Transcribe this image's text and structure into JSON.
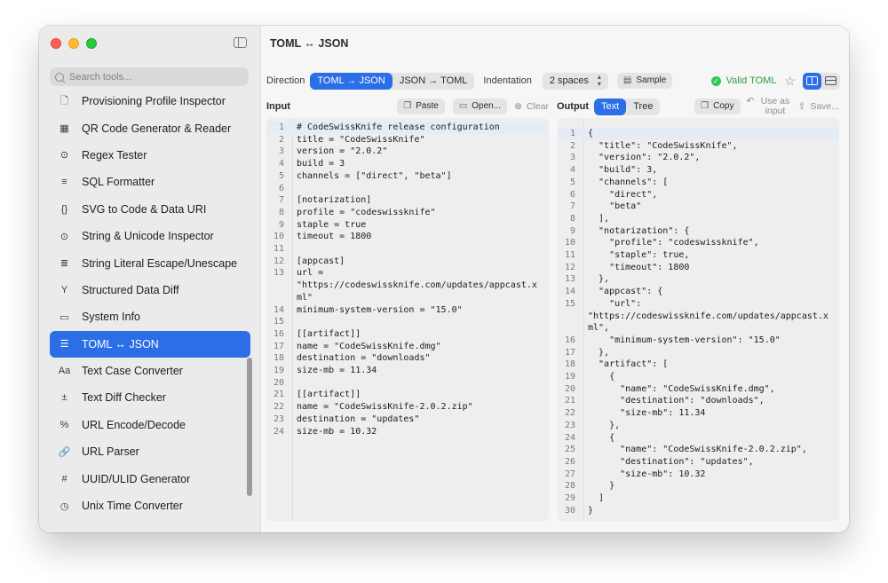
{
  "window": {
    "title": "TOML ↔ JSON"
  },
  "sidebar": {
    "search_placeholder": "Search tools...",
    "items": [
      {
        "label": "Provisioning Profile Inspector",
        "icon": "document-lock-icon",
        "glyph": "🗋",
        "active": false
      },
      {
        "label": "QR Code Generator & Reader",
        "icon": "qrcode-icon",
        "glyph": "▦",
        "active": false
      },
      {
        "label": "Regex Tester",
        "icon": "magnifier-icon",
        "glyph": "⊙",
        "active": false
      },
      {
        "label": "SQL Formatter",
        "icon": "text-align-left-icon",
        "glyph": "≡",
        "active": false
      },
      {
        "label": "SVG to Code & Data URI",
        "icon": "curly-braces-icon",
        "glyph": "{}",
        "active": false
      },
      {
        "label": "String & Unicode Inspector",
        "icon": "magnifier-text-icon",
        "glyph": "⊙",
        "active": false
      },
      {
        "label": "String Literal Escape/Unescape",
        "icon": "text-format-icon",
        "glyph": "≣",
        "active": false
      },
      {
        "label": "Structured Data Diff",
        "icon": "branch-merge-icon",
        "glyph": "Y",
        "active": false
      },
      {
        "label": "System Info",
        "icon": "display-icon",
        "glyph": "▭",
        "active": false
      },
      {
        "label": "TOML ↔ JSON",
        "icon": "sliders-icon",
        "glyph": "☰",
        "active": true
      },
      {
        "label": "Text Case Converter",
        "icon": "text-case-icon",
        "glyph": "Aa",
        "active": false
      },
      {
        "label": "Text Diff Checker",
        "icon": "plus-minus-icon",
        "glyph": "±",
        "active": false
      },
      {
        "label": "URL Encode/Decode",
        "icon": "percent-icon",
        "glyph": "%",
        "active": false
      },
      {
        "label": "URL Parser",
        "icon": "link-icon",
        "glyph": "🔗",
        "active": false
      },
      {
        "label": "UUID/ULID Generator",
        "icon": "number-square-icon",
        "glyph": "#",
        "active": false
      },
      {
        "label": "Unix Time Converter",
        "icon": "clock-icon",
        "glyph": "◷",
        "active": false
      }
    ]
  },
  "toolbar": {
    "direction_label": "Direction",
    "direction_options": [
      "TOML → JSON",
      "JSON → TOML"
    ],
    "direction_selected": "TOML → JSON",
    "indentation_label": "Indentation",
    "indentation_value": "2 spaces",
    "sample_label": "Sample",
    "valid_label": "Valid TOML",
    "colors": {
      "accent": "#2b6ee5",
      "valid": "#34c759"
    }
  },
  "input": {
    "title": "Input",
    "paste_label": "Paste",
    "open_label": "Open...",
    "clear_label": "Clear",
    "lines": [
      {
        "n": "1",
        "t": "# CodeSwissKnife release configuration"
      },
      {
        "n": "2",
        "t": "title = \"CodeSwissKnife\""
      },
      {
        "n": "3",
        "t": "version = \"2.0.2\""
      },
      {
        "n": "4",
        "t": "build = 3"
      },
      {
        "n": "5",
        "t": "channels = [\"direct\", \"beta\"]"
      },
      {
        "n": "6",
        "t": ""
      },
      {
        "n": "7",
        "t": "[notarization]"
      },
      {
        "n": "8",
        "t": "profile = \"codeswissknife\""
      },
      {
        "n": "9",
        "t": "staple = true"
      },
      {
        "n": "10",
        "t": "timeout = 1800"
      },
      {
        "n": "11",
        "t": ""
      },
      {
        "n": "12",
        "t": "[appcast]"
      },
      {
        "n": "13",
        "t": "url ="
      },
      {
        "n": "",
        "t": "\"https://codeswissknife.com/updates/appcast.x"
      },
      {
        "n": "",
        "t": "ml\""
      },
      {
        "n": "14",
        "t": "minimum-system-version = \"15.0\""
      },
      {
        "n": "15",
        "t": ""
      },
      {
        "n": "16",
        "t": "[[artifact]]"
      },
      {
        "n": "17",
        "t": "name = \"CodeSwissKnife.dmg\""
      },
      {
        "n": "18",
        "t": "destination = \"downloads\""
      },
      {
        "n": "19",
        "t": "size-mb = 11.34"
      },
      {
        "n": "20",
        "t": ""
      },
      {
        "n": "21",
        "t": "[[artifact]]"
      },
      {
        "n": "22",
        "t": "name = \"CodeSwissKnife-2.0.2.zip\""
      },
      {
        "n": "23",
        "t": "destination = \"updates\""
      },
      {
        "n": "24",
        "t": "size-mb = 10.32"
      }
    ]
  },
  "output": {
    "title": "Output",
    "view_options": [
      "Text",
      "Tree"
    ],
    "view_selected": "Text",
    "copy_label": "Copy",
    "use_as_input_label": "Use as input",
    "save_label": "Save...",
    "lines": [
      {
        "n": "1",
        "t": "{"
      },
      {
        "n": "2",
        "t": "  \"title\": \"CodeSwissKnife\","
      },
      {
        "n": "3",
        "t": "  \"version\": \"2.0.2\","
      },
      {
        "n": "4",
        "t": "  \"build\": 3,"
      },
      {
        "n": "5",
        "t": "  \"channels\": ["
      },
      {
        "n": "6",
        "t": "    \"direct\","
      },
      {
        "n": "7",
        "t": "    \"beta\""
      },
      {
        "n": "8",
        "t": "  ],"
      },
      {
        "n": "9",
        "t": "  \"notarization\": {"
      },
      {
        "n": "10",
        "t": "    \"profile\": \"codeswissknife\","
      },
      {
        "n": "11",
        "t": "    \"staple\": true,"
      },
      {
        "n": "12",
        "t": "    \"timeout\": 1800"
      },
      {
        "n": "13",
        "t": "  },"
      },
      {
        "n": "14",
        "t": "  \"appcast\": {"
      },
      {
        "n": "15",
        "t": "    \"url\":"
      },
      {
        "n": "",
        "t": "\"https://codeswissknife.com/updates/appcast.x"
      },
      {
        "n": "",
        "t": "ml\","
      },
      {
        "n": "16",
        "t": "    \"minimum-system-version\": \"15.0\""
      },
      {
        "n": "17",
        "t": "  },"
      },
      {
        "n": "18",
        "t": "  \"artifact\": ["
      },
      {
        "n": "19",
        "t": "    {"
      },
      {
        "n": "20",
        "t": "      \"name\": \"CodeSwissKnife.dmg\","
      },
      {
        "n": "21",
        "t": "      \"destination\": \"downloads\","
      },
      {
        "n": "22",
        "t": "      \"size-mb\": 11.34"
      },
      {
        "n": "23",
        "t": "    },"
      },
      {
        "n": "24",
        "t": "    {"
      },
      {
        "n": "25",
        "t": "      \"name\": \"CodeSwissKnife-2.0.2.zip\","
      },
      {
        "n": "26",
        "t": "      \"destination\": \"updates\","
      },
      {
        "n": "27",
        "t": "      \"size-mb\": 10.32"
      },
      {
        "n": "28",
        "t": "    }"
      },
      {
        "n": "29",
        "t": "  ]"
      },
      {
        "n": "30",
        "t": "}"
      }
    ]
  }
}
